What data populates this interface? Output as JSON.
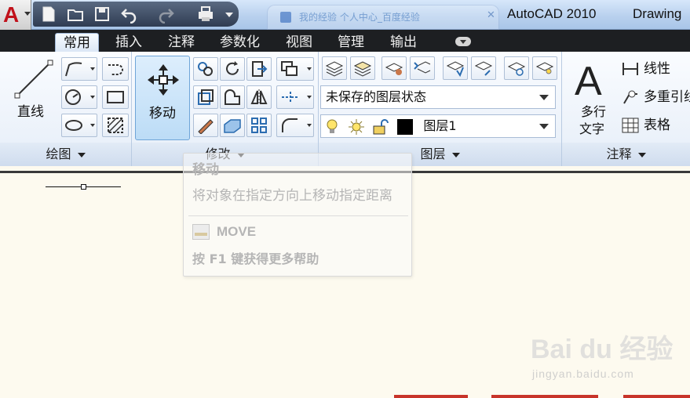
{
  "titlebar": {
    "app_title": "AutoCAD 2010",
    "drawing_title": "Drawing",
    "background_tab": "我的经验  个人中心_百度经验",
    "background_tab_close": "✕"
  },
  "ribbon_tabs": [
    {
      "label": "常用",
      "active": true
    },
    {
      "label": "插入",
      "active": false
    },
    {
      "label": "注释",
      "active": false
    },
    {
      "label": "参数化",
      "active": false
    },
    {
      "label": "视图",
      "active": false
    },
    {
      "label": "管理",
      "active": false
    },
    {
      "label": "输出",
      "active": false
    }
  ],
  "panels": {
    "draw": {
      "footer": "绘图",
      "line_label": "直线"
    },
    "modify": {
      "footer": "修改",
      "move_label": "移动"
    },
    "layers": {
      "footer": "图层",
      "layer_state": "未保存的图层状态",
      "current_layer": "图层1",
      "layer_color": "#000000"
    },
    "annotation": {
      "footer": "注释",
      "mtext_label_line1": "多行",
      "mtext_label_line2": "文字",
      "big_glyph": "A",
      "linear_label": "线性",
      "mleader_label": "多重引线",
      "table_label": "表格"
    }
  },
  "tooltip": {
    "title": "移动",
    "description": "将对象在指定方向上移动指定距离",
    "command": "MOVE",
    "help": "按 F1 键获得更多帮助"
  },
  "watermark": {
    "brand": "Bai du 经验",
    "url": "jingyan.baidu.com"
  },
  "colors": {
    "accent_red": "#c1121b",
    "tab_bar": "#1d1f22",
    "canvas": "#fdfaef",
    "move_highlight": "#bcdcf6"
  },
  "icons": [
    "autocad-logo-icon",
    "new-icon",
    "open-icon",
    "save-icon",
    "undo-icon",
    "redo-icon",
    "plot-icon",
    "line-icon",
    "polyline-icon",
    "circle-icon",
    "arc-icon",
    "rectangle-icon",
    "ellipse-icon",
    "hatch-icon",
    "move-icon",
    "rotate-icon",
    "trim-icon",
    "copy-icon",
    "mirror-icon",
    "fillet-icon",
    "stretch-icon",
    "scale-icon",
    "array-icon",
    "erase-icon",
    "offset-icon",
    "layer-properties-icon",
    "bulb-icon",
    "sun-icon",
    "lock-icon",
    "linear-dimension-icon",
    "multileader-icon",
    "table-icon"
  ]
}
